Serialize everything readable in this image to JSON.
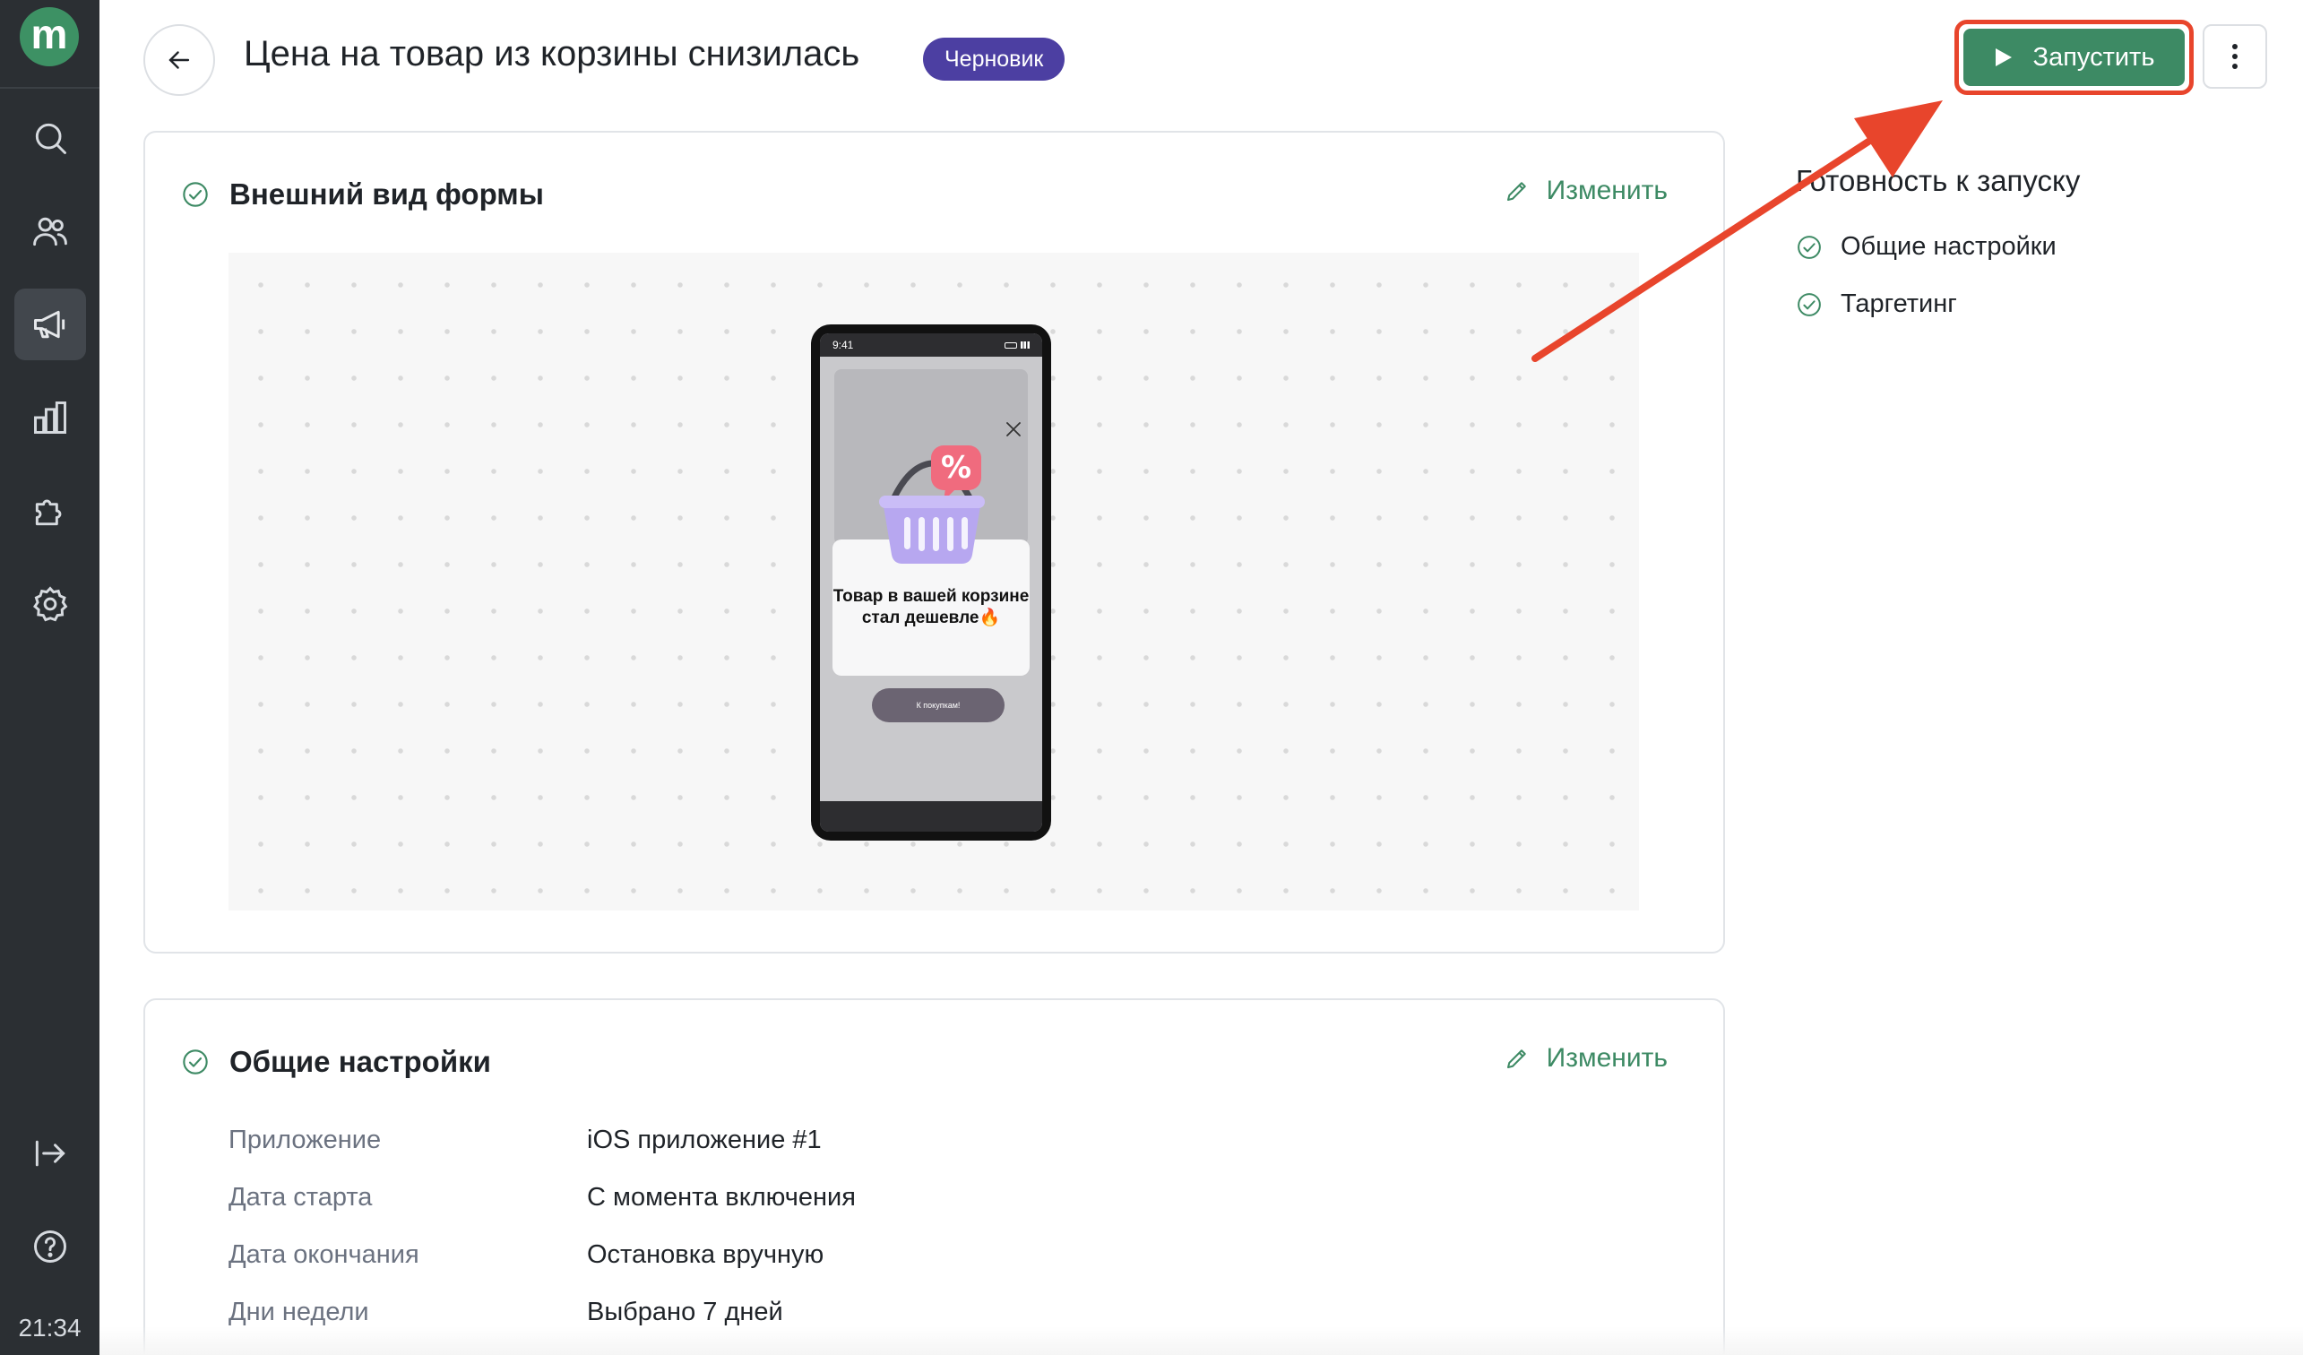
{
  "app": {
    "logo_letter": "m",
    "accent_color": "#3d8a64"
  },
  "sidebar": {
    "items": [
      {
        "name": "search",
        "icon": "search-icon"
      },
      {
        "name": "audience",
        "icon": "users-icon"
      },
      {
        "name": "campaigns",
        "icon": "megaphone-icon",
        "active": true
      },
      {
        "name": "analytics",
        "icon": "bar-chart-icon"
      },
      {
        "name": "integrations",
        "icon": "puzzle-icon"
      },
      {
        "name": "settings",
        "icon": "gear-icon"
      }
    ],
    "bottom_items": [
      {
        "name": "logout",
        "icon": "logout-icon"
      },
      {
        "name": "help",
        "icon": "help-icon"
      }
    ],
    "clock": "21:34"
  },
  "header": {
    "title": "Цена на товар из корзины снизилась",
    "status_badge": "Черновик",
    "run_label": "Запустить"
  },
  "appearance": {
    "title": "Внешний вид формы",
    "edit_label": "Изменить",
    "phone": {
      "time": "9:41",
      "popup_text": "Товар в вашей корзине стал дешевле🔥",
      "popup_button": "К покупкам!"
    }
  },
  "general": {
    "title": "Общие настройки",
    "edit_label": "Изменить",
    "rows": [
      {
        "label": "Приложение",
        "value": "iOS приложение #1"
      },
      {
        "label": "Дата старта",
        "value": "С момента включения"
      },
      {
        "label": "Дата окончания",
        "value": "Остановка вручную"
      },
      {
        "label": "Дни недели",
        "value": "Выбрано 7 дней"
      }
    ]
  },
  "readiness": {
    "title": "Готовность к запуску",
    "items": [
      {
        "label": "Общие настройки",
        "done": true
      },
      {
        "label": "Таргетинг",
        "done": true
      }
    ]
  }
}
